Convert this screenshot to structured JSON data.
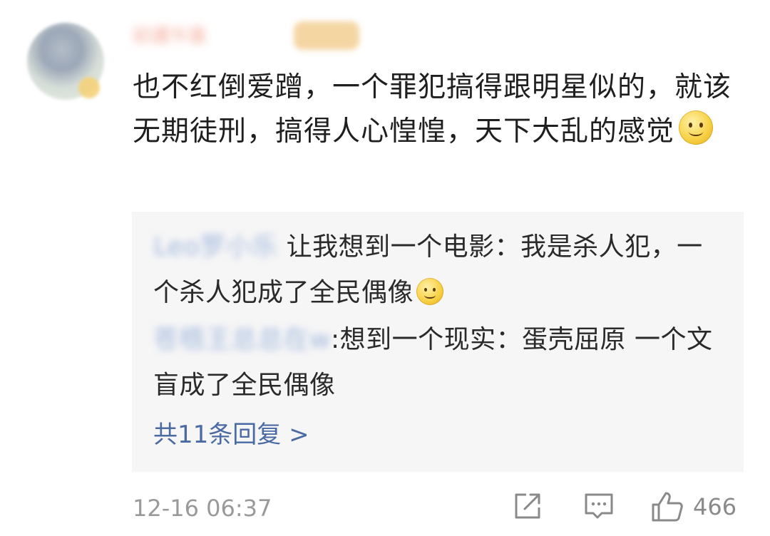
{
  "comment": {
    "username": "初遇乍喜",
    "user_tag": "铁粉",
    "text": "也不红倒爱蹭，一个罪犯搞得跟明星似的，就该无期徒刑，搞得人心惶惶，天下大乱的感觉",
    "emoji": "smile-emoji"
  },
  "replies": [
    {
      "name": "Leo罗小乐",
      "separator": " ",
      "text": "让我想到一个电影：我是杀人犯，一个杀人犯成了全民偶像",
      "emoji": "smile-emoji"
    },
    {
      "name": "苍梧王总总在w",
      "separator": ":",
      "text": "想到一个现实：蛋壳屈原 一个文盲成了全民偶像"
    }
  ],
  "more_replies": "共11条回复 >",
  "footer": {
    "timestamp": "12-16 06:37",
    "like_count": "466",
    "icons": [
      "share-icon",
      "comment-icon",
      "like-icon"
    ]
  },
  "colors": {
    "link": "#4a6aa3",
    "reply_bg": "#f6f6f6",
    "meta": "#9a9a9a"
  }
}
